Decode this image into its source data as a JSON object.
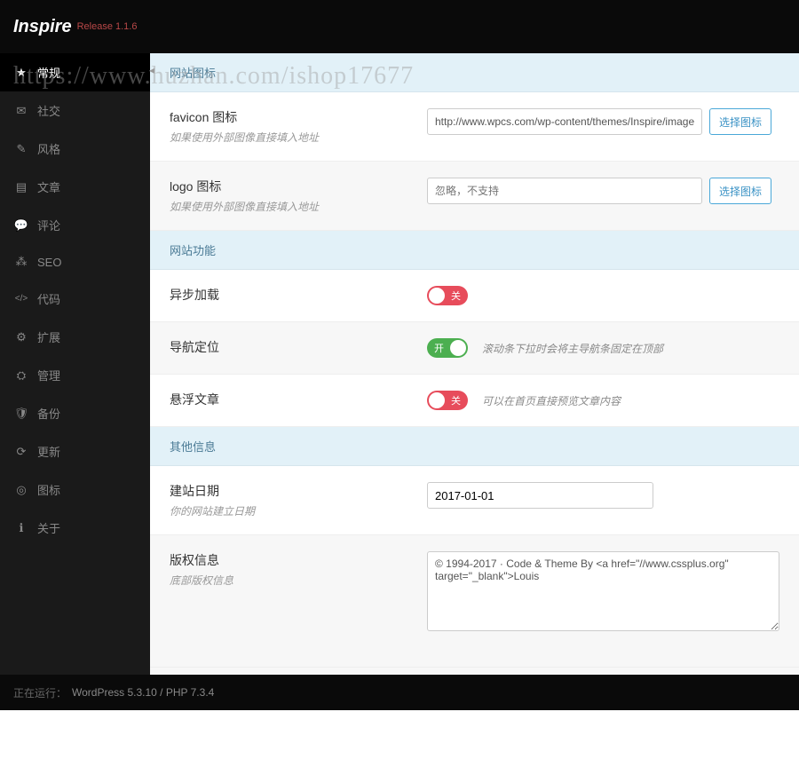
{
  "header": {
    "brand": "Inspire",
    "release": "Release 1.1.6"
  },
  "watermark": "https://www.huzhan.com/ishop17677",
  "sidebar": {
    "items": [
      {
        "label": "常规",
        "icon": "★",
        "active": true
      },
      {
        "label": "社交",
        "icon": "✉"
      },
      {
        "label": "风格",
        "icon": "✎"
      },
      {
        "label": "文章",
        "icon": "▤"
      },
      {
        "label": "评论",
        "icon": "💬"
      },
      {
        "label": "SEO",
        "icon": "⁂"
      },
      {
        "label": "代码",
        "icon": "</>"
      },
      {
        "label": "扩展",
        "icon": "⚙"
      },
      {
        "label": "管理",
        "icon": "⛭"
      },
      {
        "label": "备份",
        "icon": "🛡"
      },
      {
        "label": "更新",
        "icon": "⟳"
      },
      {
        "label": "图标",
        "icon": "◎"
      },
      {
        "label": "关于",
        "icon": "ℹ"
      }
    ]
  },
  "sections": {
    "site_icon": {
      "title": "网站图标",
      "favicon": {
        "label": "favicon 图标",
        "hint": "如果使用外部图像直接填入地址",
        "value": "http://www.wpcs.com/wp-content/themes/Inspire/images/favicon",
        "button": "选择图标"
      },
      "logo": {
        "label": "logo 图标",
        "hint": "如果使用外部图像直接填入地址",
        "placeholder": "忽略，不支持",
        "button": "选择图标"
      }
    },
    "site_func": {
      "title": "网站功能",
      "async": {
        "label": "异步加载",
        "state": "off",
        "text": "关"
      },
      "navfix": {
        "label": "导航定位",
        "state": "on",
        "text": "开",
        "hint": "滚动条下拉时会将主导航条固定在顶部"
      },
      "float": {
        "label": "悬浮文章",
        "state": "off",
        "text": "关",
        "hint": "可以在首页直接预览文章内容"
      }
    },
    "other": {
      "title": "其他信息",
      "date": {
        "label": "建站日期",
        "hint": "你的网站建立日期",
        "value": "2017-01-01"
      },
      "copyright": {
        "label": "版权信息",
        "hint": "底部版权信息",
        "value": "© 1994-2017 · Code & Theme By <a href=\"//www.cssplus.org\" target=\"_blank\">Louis"
      }
    }
  },
  "footer": {
    "label": "正在运行：",
    "value": "WordPress 5.3.10 / PHP 7.3.4"
  }
}
